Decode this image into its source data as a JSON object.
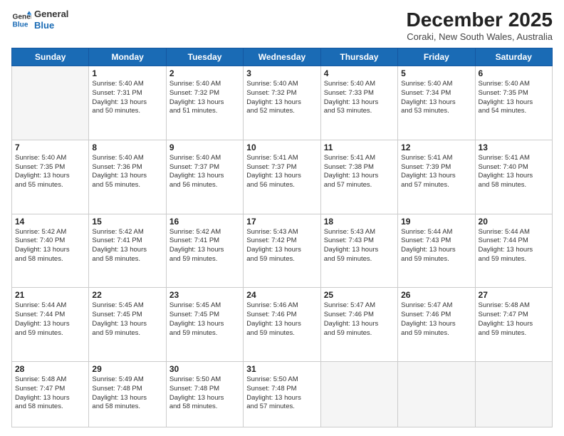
{
  "header": {
    "logo_line1": "General",
    "logo_line2": "Blue",
    "month": "December 2025",
    "location": "Coraki, New South Wales, Australia"
  },
  "weekdays": [
    "Sunday",
    "Monday",
    "Tuesday",
    "Wednesday",
    "Thursday",
    "Friday",
    "Saturday"
  ],
  "weeks": [
    [
      {
        "day": "",
        "detail": ""
      },
      {
        "day": "1",
        "detail": "Sunrise: 5:40 AM\nSunset: 7:31 PM\nDaylight: 13 hours\nand 50 minutes."
      },
      {
        "day": "2",
        "detail": "Sunrise: 5:40 AM\nSunset: 7:32 PM\nDaylight: 13 hours\nand 51 minutes."
      },
      {
        "day": "3",
        "detail": "Sunrise: 5:40 AM\nSunset: 7:32 PM\nDaylight: 13 hours\nand 52 minutes."
      },
      {
        "day": "4",
        "detail": "Sunrise: 5:40 AM\nSunset: 7:33 PM\nDaylight: 13 hours\nand 53 minutes."
      },
      {
        "day": "5",
        "detail": "Sunrise: 5:40 AM\nSunset: 7:34 PM\nDaylight: 13 hours\nand 53 minutes."
      },
      {
        "day": "6",
        "detail": "Sunrise: 5:40 AM\nSunset: 7:35 PM\nDaylight: 13 hours\nand 54 minutes."
      }
    ],
    [
      {
        "day": "7",
        "detail": "Sunrise: 5:40 AM\nSunset: 7:35 PM\nDaylight: 13 hours\nand 55 minutes."
      },
      {
        "day": "8",
        "detail": "Sunrise: 5:40 AM\nSunset: 7:36 PM\nDaylight: 13 hours\nand 55 minutes."
      },
      {
        "day": "9",
        "detail": "Sunrise: 5:40 AM\nSunset: 7:37 PM\nDaylight: 13 hours\nand 56 minutes."
      },
      {
        "day": "10",
        "detail": "Sunrise: 5:41 AM\nSunset: 7:37 PM\nDaylight: 13 hours\nand 56 minutes."
      },
      {
        "day": "11",
        "detail": "Sunrise: 5:41 AM\nSunset: 7:38 PM\nDaylight: 13 hours\nand 57 minutes."
      },
      {
        "day": "12",
        "detail": "Sunrise: 5:41 AM\nSunset: 7:39 PM\nDaylight: 13 hours\nand 57 minutes."
      },
      {
        "day": "13",
        "detail": "Sunrise: 5:41 AM\nSunset: 7:40 PM\nDaylight: 13 hours\nand 58 minutes."
      }
    ],
    [
      {
        "day": "14",
        "detail": "Sunrise: 5:42 AM\nSunset: 7:40 PM\nDaylight: 13 hours\nand 58 minutes."
      },
      {
        "day": "15",
        "detail": "Sunrise: 5:42 AM\nSunset: 7:41 PM\nDaylight: 13 hours\nand 58 minutes."
      },
      {
        "day": "16",
        "detail": "Sunrise: 5:42 AM\nSunset: 7:41 PM\nDaylight: 13 hours\nand 59 minutes."
      },
      {
        "day": "17",
        "detail": "Sunrise: 5:43 AM\nSunset: 7:42 PM\nDaylight: 13 hours\nand 59 minutes."
      },
      {
        "day": "18",
        "detail": "Sunrise: 5:43 AM\nSunset: 7:43 PM\nDaylight: 13 hours\nand 59 minutes."
      },
      {
        "day": "19",
        "detail": "Sunrise: 5:44 AM\nSunset: 7:43 PM\nDaylight: 13 hours\nand 59 minutes."
      },
      {
        "day": "20",
        "detail": "Sunrise: 5:44 AM\nSunset: 7:44 PM\nDaylight: 13 hours\nand 59 minutes."
      }
    ],
    [
      {
        "day": "21",
        "detail": "Sunrise: 5:44 AM\nSunset: 7:44 PM\nDaylight: 13 hours\nand 59 minutes."
      },
      {
        "day": "22",
        "detail": "Sunrise: 5:45 AM\nSunset: 7:45 PM\nDaylight: 13 hours\nand 59 minutes."
      },
      {
        "day": "23",
        "detail": "Sunrise: 5:45 AM\nSunset: 7:45 PM\nDaylight: 13 hours\nand 59 minutes."
      },
      {
        "day": "24",
        "detail": "Sunrise: 5:46 AM\nSunset: 7:46 PM\nDaylight: 13 hours\nand 59 minutes."
      },
      {
        "day": "25",
        "detail": "Sunrise: 5:47 AM\nSunset: 7:46 PM\nDaylight: 13 hours\nand 59 minutes."
      },
      {
        "day": "26",
        "detail": "Sunrise: 5:47 AM\nSunset: 7:46 PM\nDaylight: 13 hours\nand 59 minutes."
      },
      {
        "day": "27",
        "detail": "Sunrise: 5:48 AM\nSunset: 7:47 PM\nDaylight: 13 hours\nand 59 minutes."
      }
    ],
    [
      {
        "day": "28",
        "detail": "Sunrise: 5:48 AM\nSunset: 7:47 PM\nDaylight: 13 hours\nand 58 minutes."
      },
      {
        "day": "29",
        "detail": "Sunrise: 5:49 AM\nSunset: 7:48 PM\nDaylight: 13 hours\nand 58 minutes."
      },
      {
        "day": "30",
        "detail": "Sunrise: 5:50 AM\nSunset: 7:48 PM\nDaylight: 13 hours\nand 58 minutes."
      },
      {
        "day": "31",
        "detail": "Sunrise: 5:50 AM\nSunset: 7:48 PM\nDaylight: 13 hours\nand 57 minutes."
      },
      {
        "day": "",
        "detail": ""
      },
      {
        "day": "",
        "detail": ""
      },
      {
        "day": "",
        "detail": ""
      }
    ]
  ]
}
